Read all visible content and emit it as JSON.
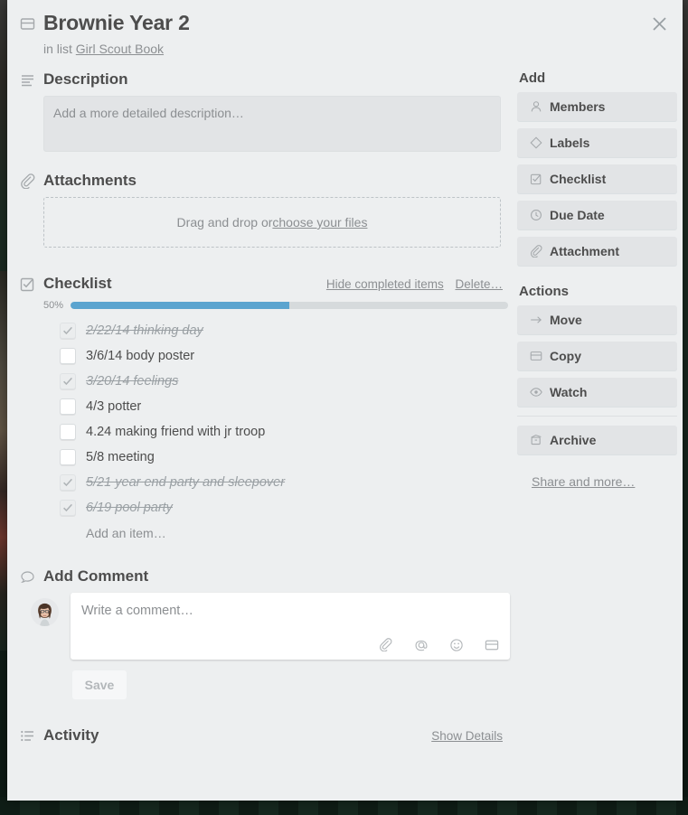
{
  "window": {
    "close_label": "×"
  },
  "card": {
    "title": "Brownie Year 2",
    "in_list_prefix": "in list",
    "list_name": "Girl Scout Book",
    "card_icon": "card-icon"
  },
  "description": {
    "heading": "Description",
    "icon": "description-lines-icon",
    "placeholder": "Add a more detailed description…"
  },
  "attachments": {
    "heading": "Attachments",
    "icon": "paperclip-icon",
    "drop_text": "Drag and drop or ",
    "drop_link": "choose your files"
  },
  "checklist": {
    "heading": "Checklist",
    "icon": "checklist-icon",
    "hide_completed_label": "Hide completed items",
    "delete_label": "Delete…",
    "progress_percent_label": "50%",
    "progress_percent": 50,
    "progress_fill_color": "#5ba4cf",
    "progress_track_color": "#d6dadc",
    "add_item_label": "Add an item…",
    "items": [
      {
        "text": "2/22/14 thinking day",
        "checked": true
      },
      {
        "text": "3/6/14 body poster",
        "checked": false
      },
      {
        "text": "3/20/14 feelings",
        "checked": true
      },
      {
        "text": "4/3 potter",
        "checked": false
      },
      {
        "text": "4.24 making friend with jr troop",
        "checked": false
      },
      {
        "text": "5/8 meeting",
        "checked": false
      },
      {
        "text": "5/21 year end party and sleepover",
        "checked": true
      },
      {
        "text": "6/19 pool party",
        "checked": true
      }
    ]
  },
  "comment": {
    "heading": "Add Comment",
    "icon": "speech-bubble-icon",
    "placeholder": "Write a comment…",
    "save_label": "Save",
    "tools": [
      "paperclip-icon",
      "mention-at-icon",
      "emoji-smiley-icon",
      "card-icon"
    ]
  },
  "activity": {
    "heading": "Activity",
    "icon": "activity-list-icon",
    "show_details_label": "Show Details"
  },
  "sidebar": {
    "add_heading": "Add",
    "actions_heading": "Actions",
    "add_items": [
      {
        "label": "Members",
        "icon": "person-icon"
      },
      {
        "label": "Labels",
        "icon": "label-tag-icon"
      },
      {
        "label": "Checklist",
        "icon": "checklist-icon"
      },
      {
        "label": "Due Date",
        "icon": "clock-icon"
      },
      {
        "label": "Attachment",
        "icon": "paperclip-icon"
      }
    ],
    "action_items": [
      {
        "label": "Move",
        "icon": "arrow-right-icon"
      },
      {
        "label": "Copy",
        "icon": "card-icon"
      },
      {
        "label": "Watch",
        "icon": "eye-icon"
      }
    ],
    "archive": {
      "label": "Archive",
      "icon": "archive-box-icon"
    },
    "share_label": "Share and more…"
  }
}
